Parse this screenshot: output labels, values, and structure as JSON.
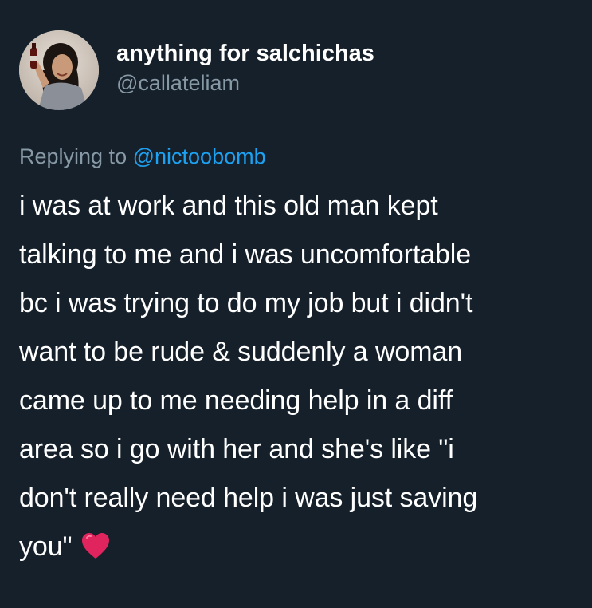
{
  "author": {
    "display_name": "anything for salchichas",
    "handle": "@callateliam"
  },
  "reply": {
    "prefix": "Replying to",
    "handle": "@nictoobomb"
  },
  "tweet": {
    "lines": [
      "i was at work and this old man kept",
      "talking to me and i was  uncomfortable",
      "bc i was trying to do my job but i didn't",
      "want to be rude & suddenly a woman",
      "came up to me needing help in a diff",
      "area so i go with her and she's like \"i",
      "don't really need help i was just saving",
      "you\""
    ],
    "trailing_emoji": "heart-icon"
  },
  "colors": {
    "background": "#15202b",
    "secondary_text": "#8899a6",
    "link": "#1da1f2",
    "heart": "#e0245e"
  }
}
